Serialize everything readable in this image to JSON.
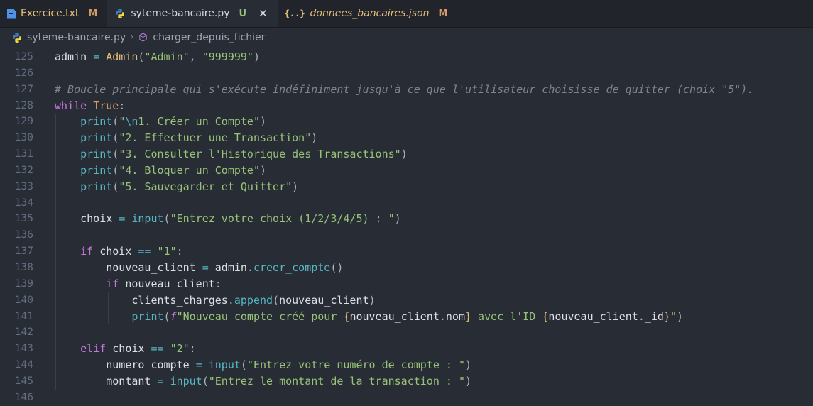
{
  "tabs": [
    {
      "name": "Exercice.txt",
      "flag": "M",
      "icon": "text-file-icon"
    },
    {
      "name": "syteme-bancaire.py",
      "flag": "U",
      "icon": "python-icon",
      "active": true
    },
    {
      "name": "donnees_bancaires.json",
      "flag": "M",
      "icon": "json-icon"
    }
  ],
  "breadcrumb": {
    "file": "syteme-bancaire.py",
    "symbol": "charger_depuis_fichier"
  },
  "code": {
    "lines": [
      {
        "n": "125"
      },
      {
        "n": "126"
      },
      {
        "n": "127"
      },
      {
        "n": "128"
      },
      {
        "n": "129"
      },
      {
        "n": "130"
      },
      {
        "n": "131"
      },
      {
        "n": "132"
      },
      {
        "n": "133"
      },
      {
        "n": "134"
      },
      {
        "n": "135"
      },
      {
        "n": "136"
      },
      {
        "n": "137"
      },
      {
        "n": "138"
      },
      {
        "n": "139"
      },
      {
        "n": "140"
      },
      {
        "n": "141"
      },
      {
        "n": "142"
      },
      {
        "n": "143"
      },
      {
        "n": "144"
      },
      {
        "n": "145"
      },
      {
        "n": "146"
      }
    ],
    "text": {
      "l125": {
        "a": "admin",
        "b": "=",
        "c": "Admin",
        "d": "(",
        "e": "\"Admin\"",
        "f": ",",
        "g": "\"999999\"",
        "h": ")"
      },
      "l127": "# Boucle principale qui s'exécute indéfiniment jusqu'à ce que l'utilisateur choisisse de quitter (choix \"5\").",
      "l128": {
        "a": "while",
        "b": "True",
        "c": ":"
      },
      "l129": {
        "a": "print",
        "b": "(",
        "c": "\"",
        "d": "\\n",
        "e": "1. Créer un Compte\"",
        "f": ")"
      },
      "l130": {
        "a": "print",
        "b": "(",
        "c": "\"2. Effectuer une Transaction\"",
        "d": ")"
      },
      "l131": {
        "a": "print",
        "b": "(",
        "c": "\"3. Consulter l'Historique des Transactions\"",
        "d": ")"
      },
      "l132": {
        "a": "print",
        "b": "(",
        "c": "\"4. Bloquer un Compte\"",
        "d": ")"
      },
      "l133": {
        "a": "print",
        "b": "(",
        "c": "\"5. Sauvegarder et Quitter\"",
        "d": ")"
      },
      "l135": {
        "a": "choix",
        "b": "=",
        "c": "input",
        "d": "(",
        "e": "\"Entrez votre choix (1/2/3/4/5) : \"",
        "f": ")"
      },
      "l137": {
        "a": "if",
        "b": "choix",
        "c": "==",
        "d": "\"1\"",
        "e": ":"
      },
      "l138": {
        "a": "nouveau_client",
        "b": "=",
        "c": "admin",
        "d": ".",
        "e": "creer_compte",
        "f": "()"
      },
      "l139": {
        "a": "if",
        "b": "nouveau_client",
        "c": ":"
      },
      "l140": {
        "a": "clients_charges",
        "b": ".",
        "c": "append",
        "d": "(",
        "e": "nouveau_client",
        "f": ")"
      },
      "l141": {
        "a": "print",
        "b": "(",
        "c": "f",
        "d": "\"Nouveau compte créé pour ",
        "e": "{",
        "f": "nouveau_client",
        "g": ".",
        "h": "nom",
        "i": "}",
        "j": " avec l'ID ",
        "k": "{",
        "l": "nouveau_client",
        "m": ".",
        "n": "_id",
        "o": "}",
        "p": "\"",
        "q": ")"
      },
      "l143": {
        "a": "elif",
        "b": "choix",
        "c": "==",
        "d": "\"2\"",
        "e": ":"
      },
      "l144": {
        "a": "numero_compte",
        "b": "=",
        "c": "input",
        "d": "(",
        "e": "\"Entrez votre numéro de compte : \"",
        "f": ")"
      },
      "l145": {
        "a": "montant",
        "b": "=",
        "c": "input",
        "d": "(",
        "e": "\"Entrez le montant de la transaction : \"",
        "f": ")"
      }
    }
  },
  "colors": {
    "background": "#282c34",
    "keyword": "#c678dd",
    "string": "#98c379",
    "function": "#61afef",
    "class": "#e5c07b",
    "comment": "#7f848e"
  }
}
